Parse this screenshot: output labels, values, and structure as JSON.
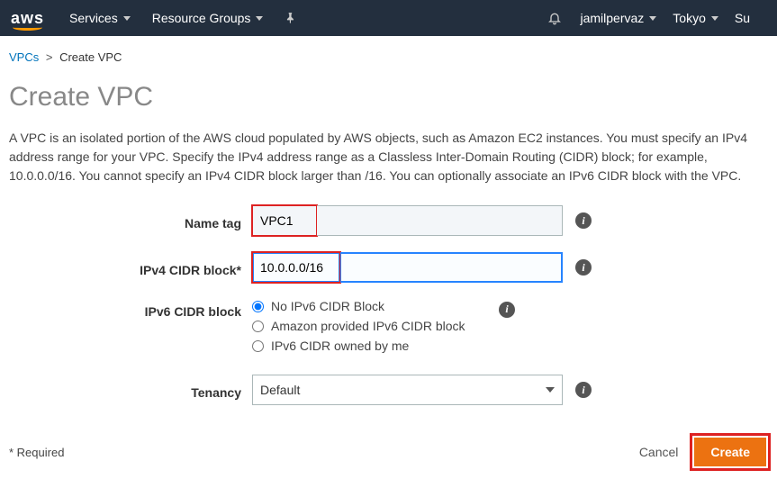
{
  "nav": {
    "logo": "aws",
    "services": "Services",
    "resource_groups": "Resource Groups",
    "user": "jamilpervaz",
    "region": "Tokyo",
    "support": "Su"
  },
  "breadcrumb": {
    "vpcs": "VPCs",
    "sep": ">",
    "current": "Create VPC"
  },
  "page": {
    "title": "Create VPC",
    "description": "A VPC is an isolated portion of the AWS cloud populated by AWS objects, such as Amazon EC2 instances. You must specify an IPv4 address range for your VPC. Specify the IPv4 address range as a Classless Inter-Domain Routing (CIDR) block; for example, 10.0.0.0/16. You cannot specify an IPv4 CIDR block larger than /16. You can optionally associate an IPv6 CIDR block with the VPC."
  },
  "form": {
    "name_tag": {
      "label": "Name tag",
      "value": "VPC1"
    },
    "ipv4_cidr": {
      "label": "IPv4 CIDR block*",
      "value": "10.0.0.0/16"
    },
    "ipv6_cidr": {
      "label": "IPv6 CIDR block",
      "options": {
        "none": "No IPv6 CIDR Block",
        "amazon": "Amazon provided IPv6 CIDR block",
        "owned": "IPv6 CIDR owned by me"
      }
    },
    "tenancy": {
      "label": "Tenancy",
      "value": "Default"
    }
  },
  "footer": {
    "required": "* Required",
    "cancel": "Cancel",
    "create": "Create"
  }
}
